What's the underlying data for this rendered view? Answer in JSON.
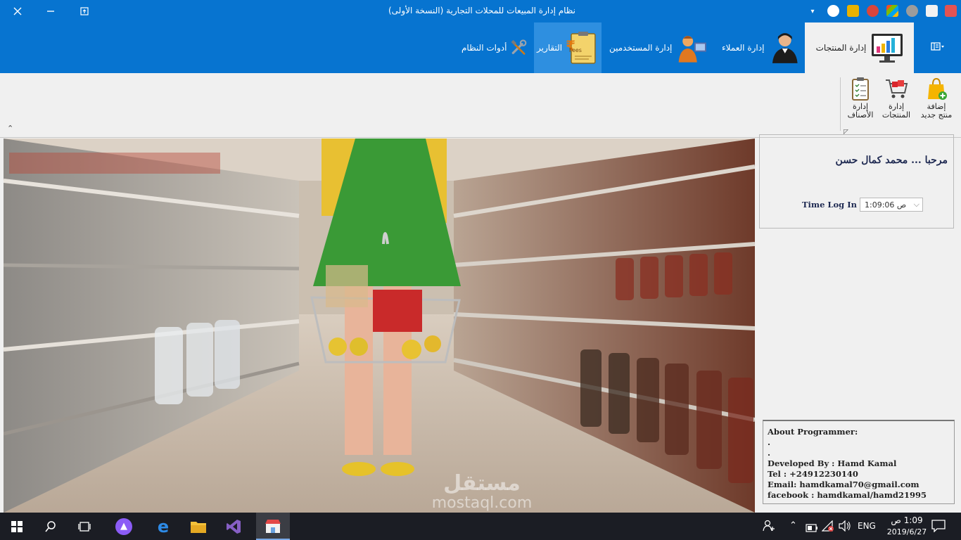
{
  "window": {
    "title": "نظام إدارة المبيعات للمحلات التجارية (النسخة الأولى)"
  },
  "ribbon_tabs": [
    {
      "label": "إدارة المنتجات",
      "icon": "chart-monitor-icon",
      "state": "active"
    },
    {
      "label": "إدارة العملاء",
      "icon": "customer-person-icon",
      "state": "normal"
    },
    {
      "label": "إدارة المستخدمين",
      "icon": "user-computer-icon",
      "state": "normal"
    },
    {
      "label": "التقارير",
      "icon": "fees-report-icon",
      "state": "hover"
    },
    {
      "label": "أدوات النظام",
      "icon": "tools-icon",
      "state": "normal"
    }
  ],
  "ribbon_buttons": [
    {
      "line1": "إضافة",
      "line2": "منتج جديد",
      "icon": "shopping-bag-add-icon"
    },
    {
      "line1": "إدارة",
      "line2": "المنتجات",
      "icon": "shopping-cart-icon"
    },
    {
      "line1": "إدارة",
      "line2": "الأصناف",
      "icon": "clipboard-list-icon"
    }
  ],
  "welcome": {
    "text": "مرحبا ... محمد كمال حسن",
    "time_label": "Time Log In :",
    "time_value": "1:09:06 ص"
  },
  "about": {
    "heading": "About Programmer:",
    "dot1": ".",
    "dot2": ".",
    "developer": "Developed By : Hamd Kamal",
    "tel": "Tel :      +24912230140",
    "email": "Email:  hamdkamal70@gmail.com",
    "facebook": "facebook :   hamdkamal/hamd21995"
  },
  "taskbar": {
    "language": "ENG",
    "time": "1:09 ص",
    "date": "2019/6/27"
  },
  "watermark": {
    "arabic": "مستقل",
    "latin": "mostaql.com"
  },
  "colors": {
    "ribbon_blue": "#0774d0",
    "taskbar": "#1b1d24",
    "welcome_text": "#1f2a52"
  }
}
